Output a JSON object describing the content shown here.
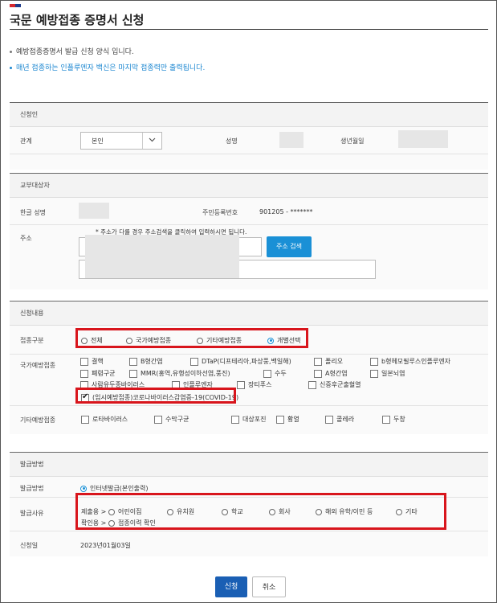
{
  "page": {
    "title": "국문 예방접종 증명서 신청",
    "note1": "예방접종증명서 발급 신청 양식 입니다.",
    "note2": "매년 접종하는 인플루엔자 백신은 마지막 접종력만 출력됩니다."
  },
  "applicant": {
    "section": "신청인",
    "relation_label": "관계",
    "relation_value": "본인",
    "name_label": "성명",
    "birth_label": "생년월일"
  },
  "recipient": {
    "section": "교부대상자",
    "korean_name_label": "한글 성명",
    "rrn_label": "주민등록번호",
    "rrn_value": "901205  -  *******",
    "address_label": "주소",
    "address_hint": "* 주소가 다를 경우 주소검색을 클릭하여 입력하시면 됩니다.",
    "address_search": "주소 검색"
  },
  "content": {
    "section": "신청내용",
    "type_label": "접종구분",
    "type_options": [
      "전체",
      "국가예방접종",
      "기타예방접종",
      "개별선택"
    ],
    "national_label": "국가예방접종",
    "national_items": [
      "결핵",
      "B형간염",
      "DTaP(디프테리아,파상풍,백일해)",
      "폴리오",
      "b형헤모필루스인플루엔자",
      "폐렴구균",
      "MMR(홍역,유행성이하선염,풍진)",
      "수두",
      "A형간염",
      "일본뇌염",
      "사람유두종바이러스",
      "인플루엔자",
      "장티푸스",
      "신증후군출혈열"
    ],
    "covid_item": "(임시예방접종)코로나바이러스감염증-19(COVID-19)",
    "other_label": "기타예방접종",
    "other_items": [
      "로타바이러스",
      "수막구균",
      "대상포진",
      "황열",
      "콜레라",
      "두창"
    ]
  },
  "issue": {
    "section": "발급방법",
    "method_label": "발급방법",
    "method_value": "인터넷발급(본인출력)",
    "reason_label": "발급사유",
    "submit_prefix": "제출용 >",
    "submit_options": [
      "어린이집",
      "유치원",
      "학교",
      "회사",
      "해외 유학/이민 등",
      "기타"
    ],
    "check_prefix": "확인용 >",
    "check_options": [
      "접종이력 확인"
    ],
    "date_label": "신청일",
    "date_value": "2023년01월03일"
  },
  "buttons": {
    "apply": "신청",
    "cancel": "취소"
  },
  "colors": {
    "accent": "#1a90d6",
    "highlight": "#d8151c",
    "notice": "#1a86d0"
  }
}
